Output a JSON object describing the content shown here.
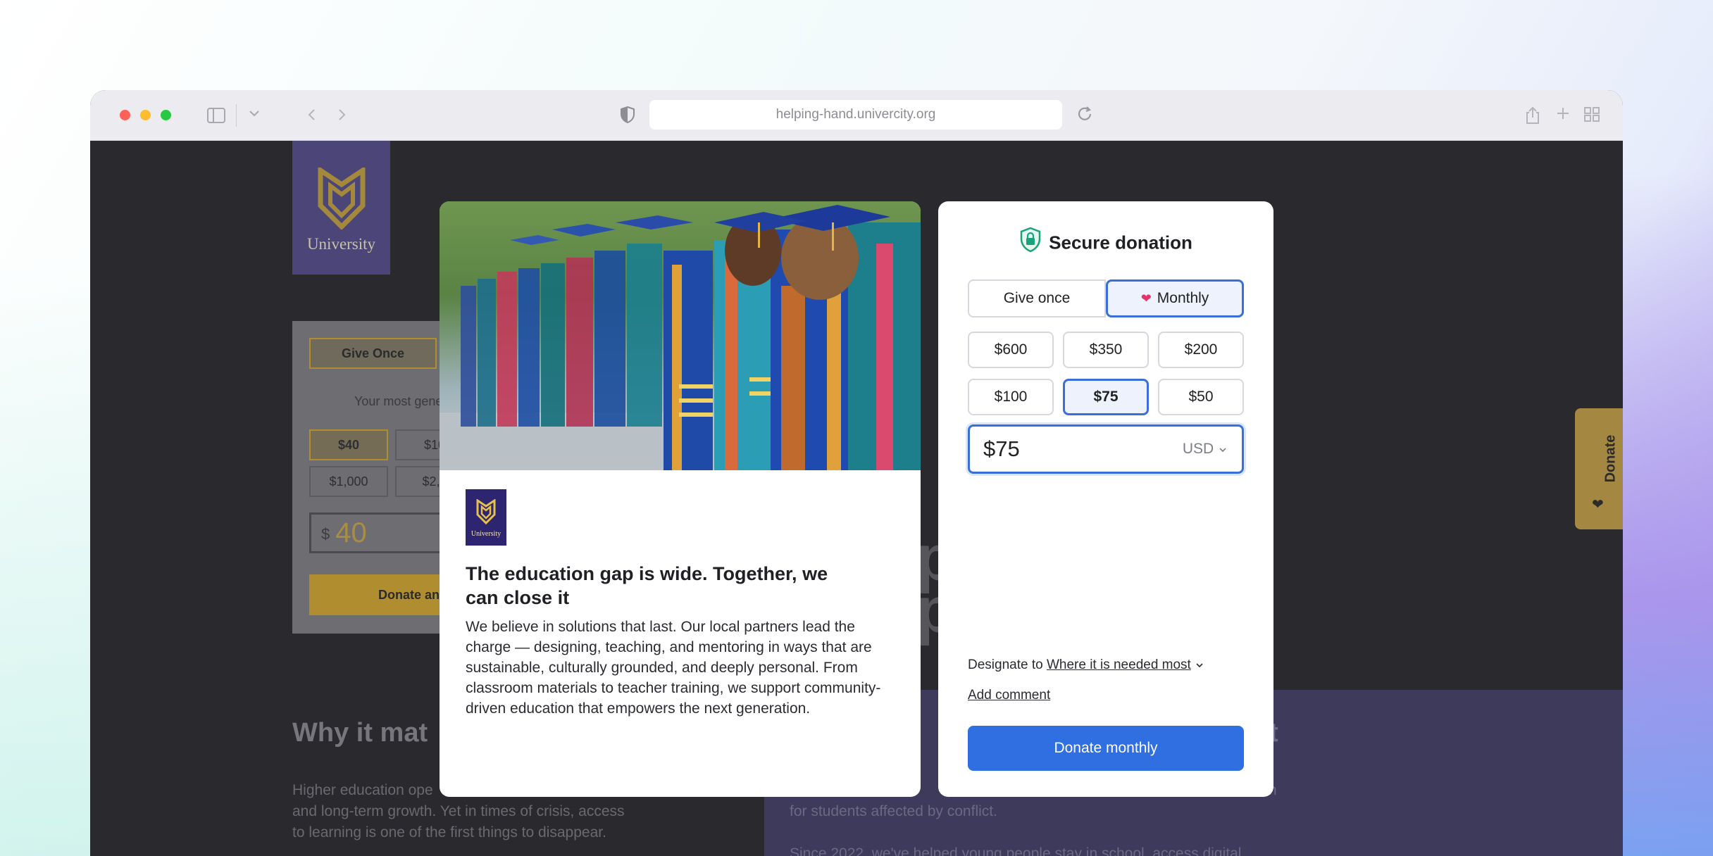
{
  "browser": {
    "url": "helping-hand.univercity.org"
  },
  "background_page": {
    "logo_word": "University",
    "widget": {
      "tab_label": "Give Once",
      "text": "Your most gene",
      "amounts": [
        "$40",
        "$10",
        "$1,000",
        "$2,5"
      ],
      "input_currency": "$",
      "input_value": "40",
      "button_label": "Donate an"
    },
    "heading_left": "Why it mat",
    "heading_right": "te                                                   act",
    "para_left": "Higher education ope                                          and long-term growth. Yet in times of crisis, access to learning is one of the first things to disappear.",
    "para_right_1": "                                                                       n for students affected by conflict.",
    "para_right_2": "Since 2022, we've helped young people stay in school, access digital",
    "big_text": "p\np",
    "side_tab_label": "Donate"
  },
  "campaign": {
    "org_badge_word": "University",
    "headline": "The education gap is wide. Together, we can close it",
    "body": "We believe in solutions that last. Our local partners lead the charge — designing, teaching, and mentoring in ways that are sustainable, culturally grounded, and deeply personal. From classroom materials to teacher training, we support community-driven education that empowers the next generation."
  },
  "donation_form": {
    "title": "Secure donation",
    "frequency": {
      "once_label": "Give once",
      "monthly_label": "Monthly",
      "selected": "Monthly"
    },
    "amounts": [
      "$600",
      "$350",
      "$200",
      "$100",
      "$75",
      "$50"
    ],
    "selected_amount": "$75",
    "input_value": "$75",
    "currency": "USD",
    "designate_prefix": "Designate to",
    "designate_value": "Where it is needed most",
    "add_comment_label": "Add comment",
    "submit_label": "Donate monthly",
    "colors": {
      "primary": "#2f6fe2",
      "selected_border": "#3b6fd8",
      "selected_fill": "#edf2fd",
      "heart": "#e5336b",
      "shield": "#19a37a"
    }
  }
}
